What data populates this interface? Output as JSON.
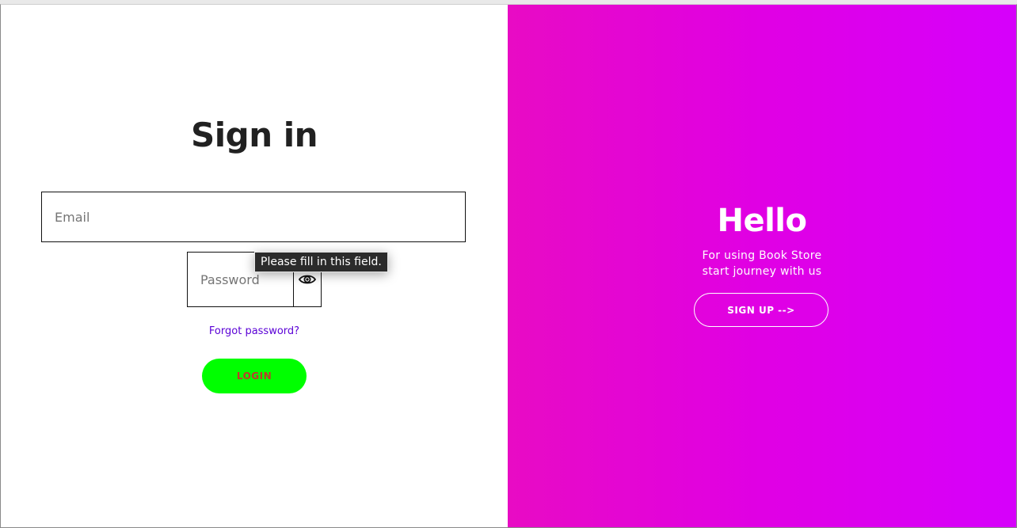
{
  "signin": {
    "title": "Sign in",
    "email_placeholder": "Email",
    "password_placeholder": "Password",
    "eye_icon": "eye-icon",
    "forgot_label": "Forgot password?",
    "login_label": "LOGIN"
  },
  "tooltip": {
    "text": "Please fill in this field."
  },
  "welcome": {
    "title": "Hello",
    "line1": "For using Book Store",
    "line2": "start journey with us",
    "signup_label": "SIGN UP -->"
  },
  "colors": {
    "login_bg": "#00ff00",
    "login_text": "#c0392b",
    "link": "#5a00d6",
    "panel_gradient_start": "#e80bc4",
    "panel_gradient_end": "#d600fb"
  }
}
